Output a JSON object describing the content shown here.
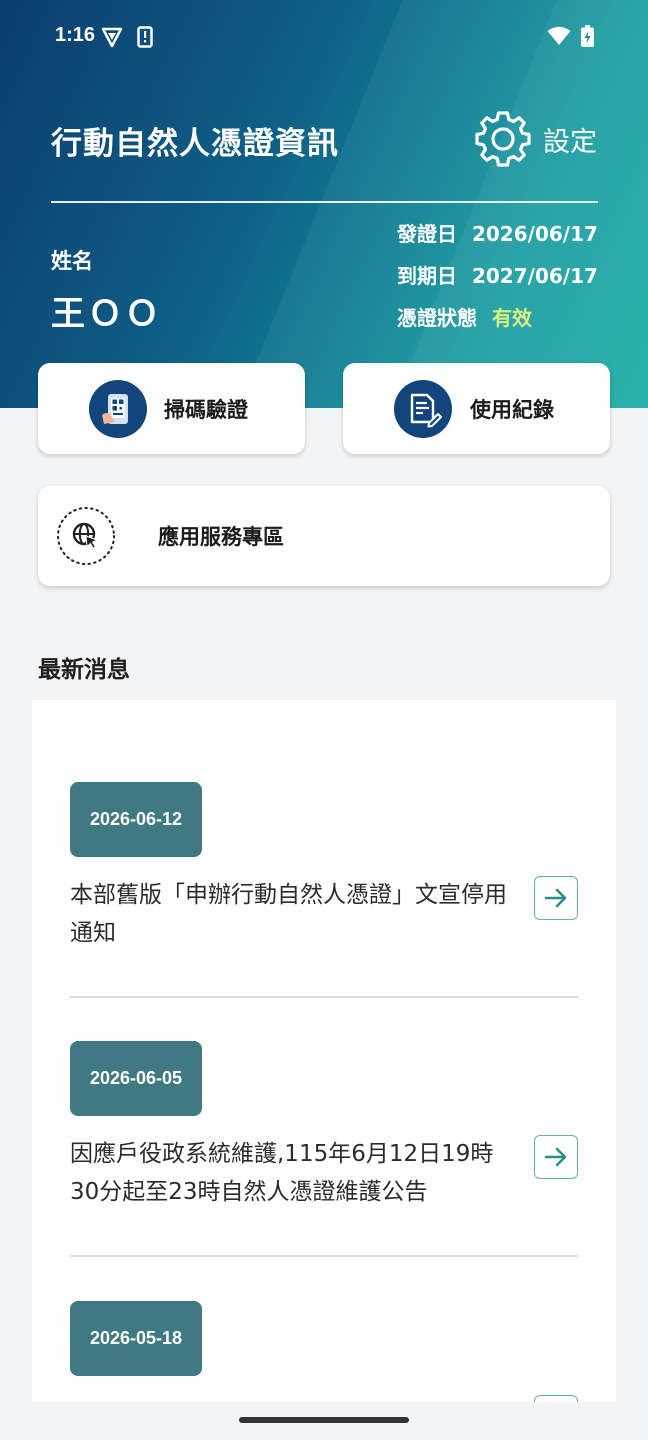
{
  "status_bar": {
    "time": "1:16"
  },
  "header": {
    "title": "行動自然人憑證資訊",
    "settings_label": "設定",
    "name_label": "姓名",
    "name_value": "王ＯＯ",
    "issue_date_label": "發證日",
    "issue_date": "2026/06/17",
    "expiry_date_label": "到期日",
    "expiry_date": "2027/06/17",
    "status_label": "憑證狀態",
    "status_value": "有效"
  },
  "actions": {
    "scan_label": "掃碼驗證",
    "history_label": "使用紀錄",
    "services_label": "應用服務專區"
  },
  "news": {
    "section_title": "最新消息",
    "items": [
      {
        "date": "2026-06-12",
        "text": "本部舊版「申辦行動自然人憑證」文宣停用通知"
      },
      {
        "date": "2026-06-05",
        "text": "因應戶役政系統維護,115年6月12日19時30分起至23時自然人憑證維護公告"
      },
      {
        "date": "2026-05-18",
        "text": ""
      }
    ]
  },
  "colors": {
    "accent": "#3f7a82",
    "status_valid": "#d8f27a",
    "icon_navy": "#12457c",
    "arrow_border": "#5fb3ad"
  }
}
